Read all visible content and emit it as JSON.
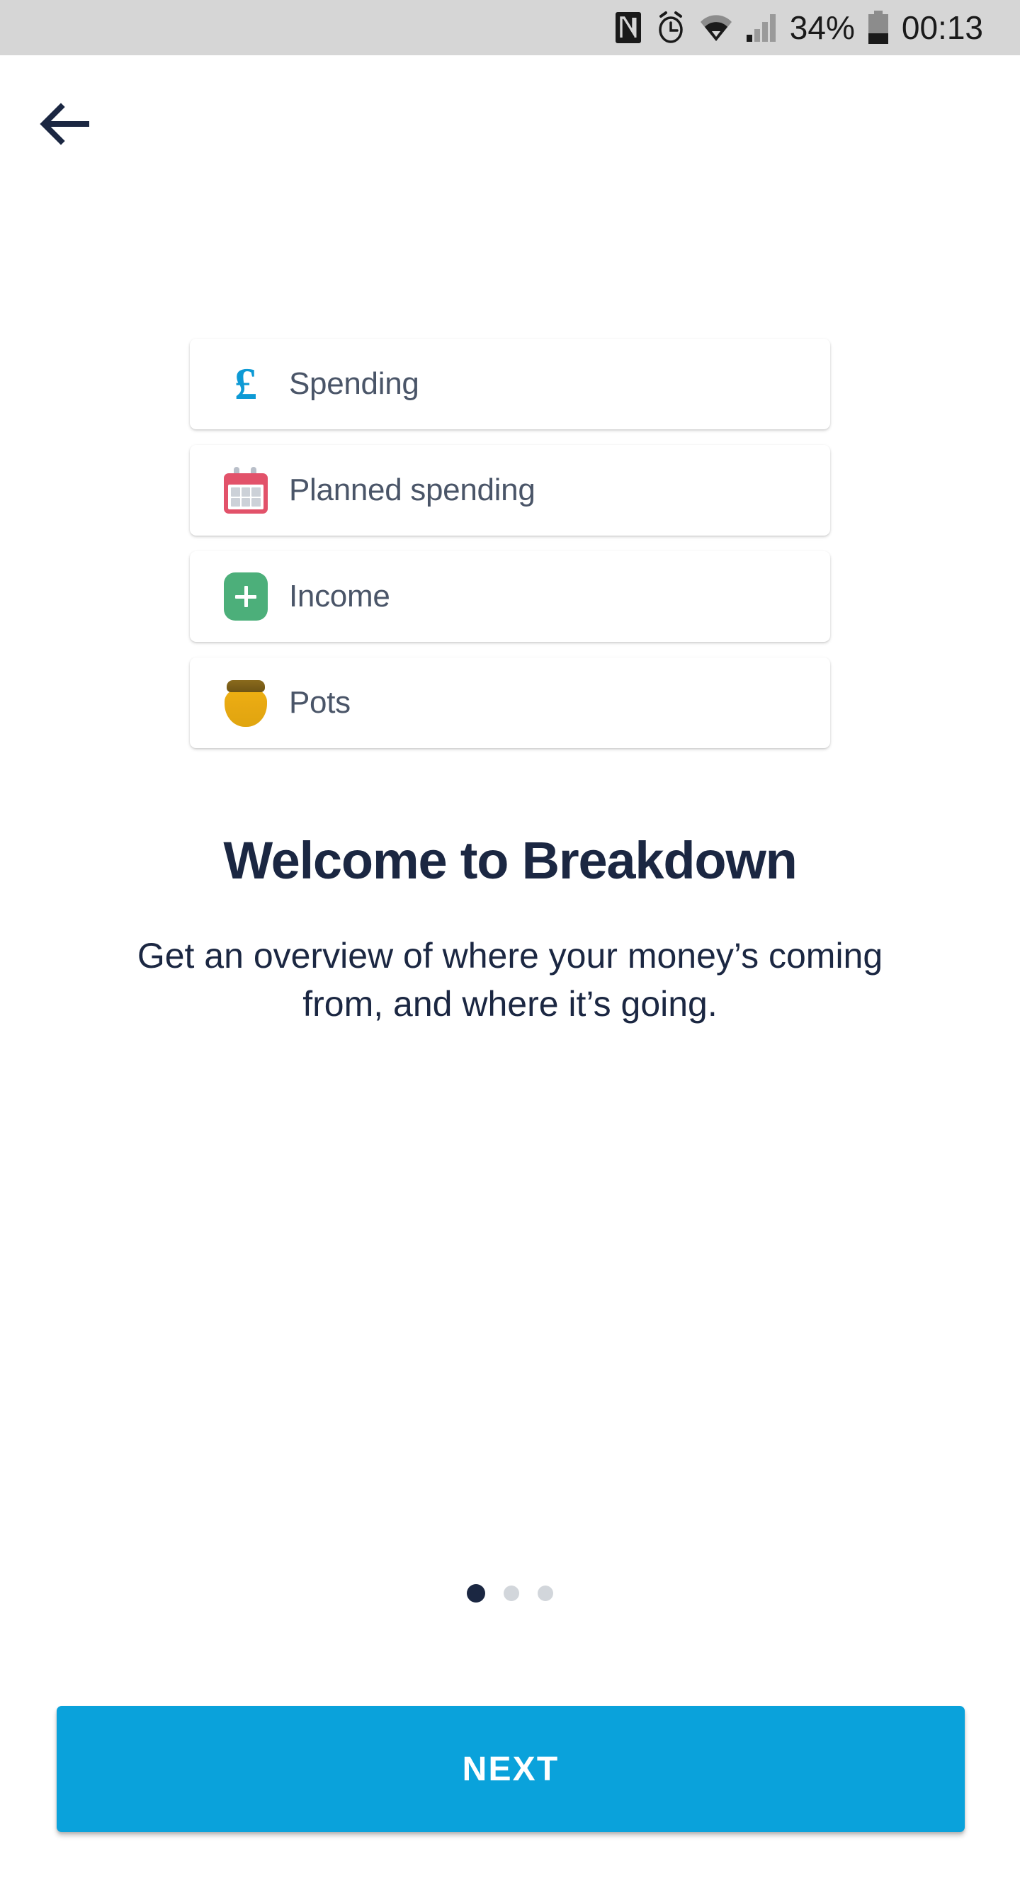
{
  "status_bar": {
    "nfc_icon": "nfc-icon",
    "alarm_icon": "alarm-clock-icon",
    "wifi_icon": "wifi-icon",
    "signal_icon": "cellular-signal-icon",
    "battery_percent": "34%",
    "battery_icon": "battery-icon",
    "time": "00:13",
    "background_color": "#d6d6d6",
    "text_color": "#1a1a1a"
  },
  "header": {
    "back_icon": "back-arrow-icon",
    "back_color": "#1b2742"
  },
  "cards": [
    {
      "id": "spending",
      "label": "Spending",
      "icon": "pound-sterling-icon",
      "icon_color": "#0d9ad5"
    },
    {
      "id": "planned-spending",
      "label": "Planned spending",
      "icon": "calendar-icon",
      "icon_color": "#e2526a"
    },
    {
      "id": "income",
      "label": "Income",
      "icon": "plus-icon",
      "icon_color": "#4caf7a"
    },
    {
      "id": "pots",
      "label": "Pots",
      "icon": "honey-pot-icon",
      "icon_color": "#e8a912"
    }
  ],
  "main": {
    "headline": "Welcome to Breakdown",
    "subtext": "Get an overview of where your money’s coming from, and where it’s going.",
    "headline_color": "#1b2742",
    "subtext_color": "#1b2742"
  },
  "pagination": {
    "total": 3,
    "active_index": 1,
    "active_color": "#1b2742",
    "inactive_color": "#d2d6db"
  },
  "footer": {
    "next_label": "NEXT",
    "next_color": "#0aa2db",
    "next_text_color": "#ffffff"
  }
}
